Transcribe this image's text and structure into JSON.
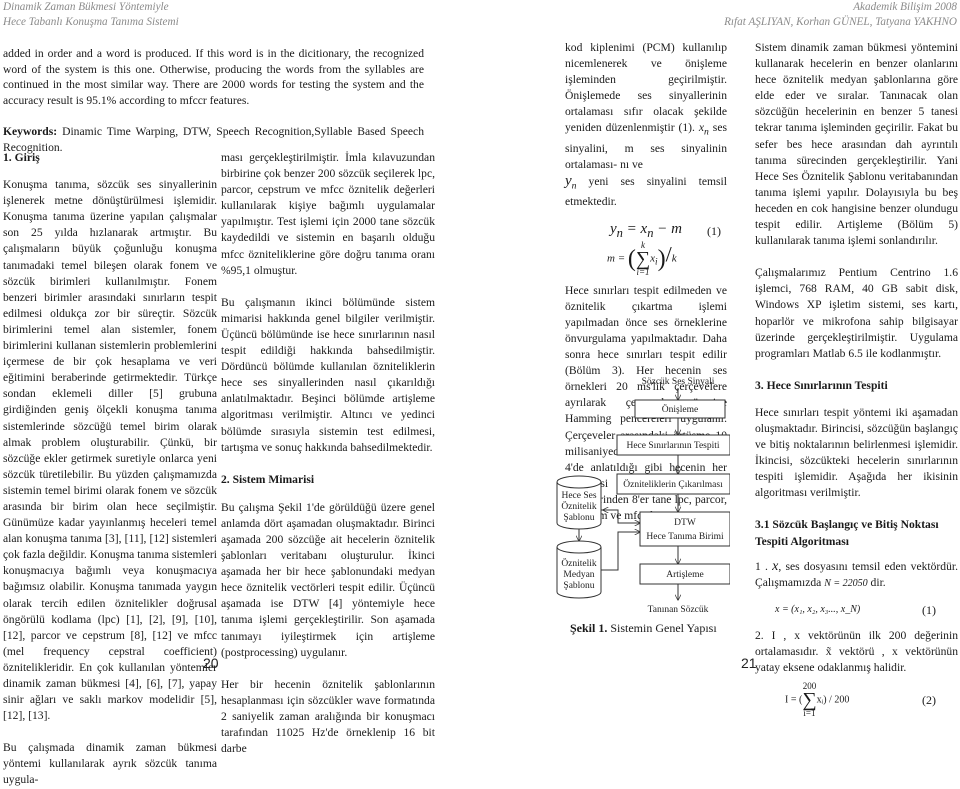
{
  "header": {
    "left_line1": "Dinamik Zaman Bükmesi Yöntemiyle",
    "left_line2": "Hece Tabanlı Konuşma Tanıma Sistemi",
    "right_line1": "Akademik Bilişim 2008",
    "right_line2": "Rıfat AŞLIYAN, Korhan GÜNEL, Tatyana YAKHNO"
  },
  "abstract": {
    "text": "added in order and a word is produced. If this word is in the dicitionary, the recognized word of the system is this one. Otherwise, producing the words from the syllables are continued in the most similar way. There are 2000 words for testing the system and the accuracy result is 95.1% according to mfccr features.",
    "keywords_label": "Keywords:",
    "keywords": " Dinamic Time Warping, DTW, Speech Recognition,Syllable Based Speech Recognition."
  },
  "col1": {
    "heading": "1. Giriş",
    "p1": "Konuşma tanıma, sözcük ses sinyallerinin işlenerek metne dönüştürülmesi işlemidir. Konuşma tanıma üzerine yapılan çalışmalar son 25 yılda hızlanarak artmıştır. Bu çalışmaların büyük çoğunluğu konuşma tanımadaki temel bileşen olarak fonem ve sözcük birimleri kullanılmıştır. Fonem benzeri birimler arasındaki sınırların tespit edilmesi oldukça zor bir süreçtir. Sözcük birimlerini temel alan sistemler, fonem birimlerini kullanan sistemlerin problemlerini içermese de bir çok hesaplama ve veri eğitimini beraberinde getirmektedir. Türkçe sondan eklemeli diller [5] grubuna girdiğinden geniş ölçekli konuşma tanıma sistemlerinde sözcüğü temel birim olarak almak problem oluşturabilir. Çünkü, bir sözcüğe ekler getirmek suretiyle onlarca yeni sözcük türetilebilir. Bu yüzden çalışmamızda sistemin temel birimi olarak fonem ve sözcük arasında bir birim olan hece seçilmiştir. Günümüze kadar yayınlanmış heceleri temel alan konuşma tanıma [3], [11], [12] sistemleri çok fazla değildir. Konuşma tanıma sistemleri konuşmacıya bağımlı veya konuşmacıya bağımsız olabilir. Konuşma tanımada yaygın olarak tercih edilen öznitelikler doğrusal öngörülü kodlama (lpc) [1], [2], [9], [10], [12], parcor ve cepstrum [8], [12] ve mfcc (mel frequency cepstral coefficient) öznitelikleridir. En çok kullanılan yöntemler dinamik zaman bükmesi [4], [6], [7], yapay sinir ağları ve saklı markov modelidir [5], [12], [13].",
    "p2": "Bu çalışmada dinamik zaman bükmesi yöntemi kullanılarak ayrık sözcük tanıma uygula-"
  },
  "col2": {
    "p1": "ması gerçekleştirilmiştir. İmla kılavuzundan birbirine çok benzer 200 sözcük seçilerek lpc, parcor, cepstrum ve mfcc öznitelik değerleri kullanılarak kişiye bağımlı uygulamalar yapılmıştır. Test işlemi için 2000 tane sözcük kaydedildi ve sistemin en başarılı olduğu mfcc özniteliklerine göre doğru tanıma oranı %95,1 olmuştur.",
    "p2": "Bu çalışmanın ikinci bölümünde sistem mimarisi hakkında genel bilgiler verilmiştir. Üçüncü bölümünde ise hece sınırlarının nasıl tespit edildiği hakkında bahsedilmiştir. Dördüncü bölümde kullanılan özniteliklerin hece ses sinyallerinden nasıl çıkarıldığı anlatılmaktadır. Beşinci bölümde artişleme algoritması verilmiştir. Altıncı ve yedinci bölümde sırasıyla sistemin test edilmesi, tartışma ve sonuç hakkında bahsedilmektedir.",
    "heading": "2. Sistem Mimarisi",
    "p3": "Bu çalışma Şekil 1'de görüldüğü üzere genel anlamda dört aşamadan oluşmaktadır. Birinci aşamada 200 sözcüğe ait hecelerin öznitelik şablonları veritabanı oluşturulur. İkinci aşamada her bir hece şablonundaki medyan hece öznitelik vectörleri tespit edilir. Üçüncü aşamada ise DTW [4] yöntemiyle hece tanıma işlemi gerçekleştirilir. Son aşamada tanımayı iyileştirmek için artişleme (postprocessing) uygulanır.",
    "p4": "Her bir hecenin öznitelik şablonlarının hesaplanması için sözcükler wave formatında 2 saniyelik zaman aralığında bir konuşmacı tarafından 11025 Hz'de örneklenip 16 bit darbe"
  },
  "col3": {
    "p1_a": "kod kiplenimi (PCM) kullanılıp nicemlenerek ve önişleme işleminden geçirilmiştir. Önişlemede ses sinyallerinin ortalaması sıfır olacak şekilde yeniden düzenlenmiştir (1).",
    "p1_xn": "x",
    "p1_b": " ses sinyalini, m ses sinyalinin ortalaması- ",
    "p1_c": "nı ve",
    "p1_yn": "y",
    "p1_d": " yeni ses sinyalini temsil etmektedir.",
    "eq1_lhs": "y",
    "eq1_rhs": " = x",
    "eq1_tail": " − m",
    "eq1_num": "(1)",
    "eq2_m": "m =",
    "eq2_top": "k",
    "eq2_bottom": "i=1",
    "eq2_x": "x",
    "eq2_div": "k",
    "p2": "Hece sınırları tespit edilmeden ve öznitelik çıkartma işlemi yapılmadan önce ses örneklerine önvurgulama yapılmaktadır. Daha sonra hece sınırları tespit edilir (Bölüm 3). Her hecenin ses örnekleri 20 ms'lik çerçevelere ayrılarak çerçeveler üzerine Hamming pencereleri uygulanır. Çerçeveler arasındaki örtüşme 10 milisaniyedir. Daha sonra Bölüm 4'de anlatıldığı gibi hecenin her çerçevesi için öznitelik değerlerinden 8'er tane lpc, parcor, cepstrum ve mfcc hesaplanır."
  },
  "diagram": {
    "input": "Sözcük Ses Sinyali",
    "box1": "Önişleme",
    "box2": "Hece Sınırlarının Tespiti",
    "box3": "Özniteliklerin Çıkarılması",
    "box4_line1": "DTW",
    "box4_line2": "Hece Tanıma Birimi",
    "box5": "Artişleme",
    "output": "Tanınan Sözcük",
    "db1_line1": "Hece Ses",
    "db1_line2": "Öznitelik",
    "db1_line3": "Şablonu",
    "db2_line1": "Öznitelik",
    "db2_line2": "Medyan",
    "db2_line3": "Şablonu",
    "caption_label": "Şekil 1.",
    "caption_text": " Sistemin Genel Yapısı"
  },
  "col4": {
    "p1": "Sistem dinamik zaman bükmesi yöntemini kullanarak hecelerin en benzer olanlarını hece öznitelik medyan şablonlarına göre elde eder ve sıralar. Tanınacak olan sözcüğün hecelerinin en benzer 5 tanesi tekrar tanıma işleminden geçirilir. Fakat bu sefer bes hece arasından dah ayrıntılı tanıma sürecinden gerçekleştirilir. Yani Hece Ses Öznitelik Şablonu veritabanından tanıma işlemi yapılır. Dolayısıyla bu beş heceden en cok hangisine benzer olundugu tespit edilir. Artişleme (Bölüm 5) kullanılarak tanıma işlemi sonlandırılır.",
    "p2": "Çalışmalarımız Pentium Centrino 1.6 işlemci, 768 RAM, 40 GB sabit disk, Windows XP işletim sistemi, ses kartı, hoparlör ve mikrofona sahip bilgisayar üzerinde gerçekleştirilmiştir. Uygulama programları Matlab 6.5 ile kodlanmıştır.",
    "heading3": "3. Hece Sınırlarının Tespiti",
    "p3": "Hece sınırları tespit yöntemi iki aşamadan oluşmaktadır. Birincisi, sözcüğün başlangıç ve bitiş noktalarının belirlenmesi işlemidir. İkincisi, sözcükteki hecelerin sınırlarının tespiti işlemidir. Aşağıda her ikisinin algoritması verilmiştir.",
    "heading31": "3.1 Sözcük Başlangıç ve Bitiş Noktası Tespiti Algoritması",
    "step1_a": "1 . ",
    "step1_x": "x",
    "step1_b": ", ses dosyasını temsil eden vektördür. Çalışmamızda ",
    "step1_n": "N = 22050",
    "step1_c": " dir.",
    "eq_x": "x = (x₁, x₂, x₃..., x_N)",
    "eq_x_num": "(1)",
    "step2": "2. I , x vektörünün ilk 200 değerinin ortalamasıdır. x̃ vektörü , x vektörünün yatay eksene odaklanmış halidir.",
    "eq_i_lhs": "I = (",
    "eq_i_top": "200",
    "eq_i_bottom": "i=1",
    "eq_i_body": "xᵢ) / 200",
    "eq_i_num": "(2)"
  },
  "page_numbers": {
    "left": "20",
    "right": "21"
  }
}
